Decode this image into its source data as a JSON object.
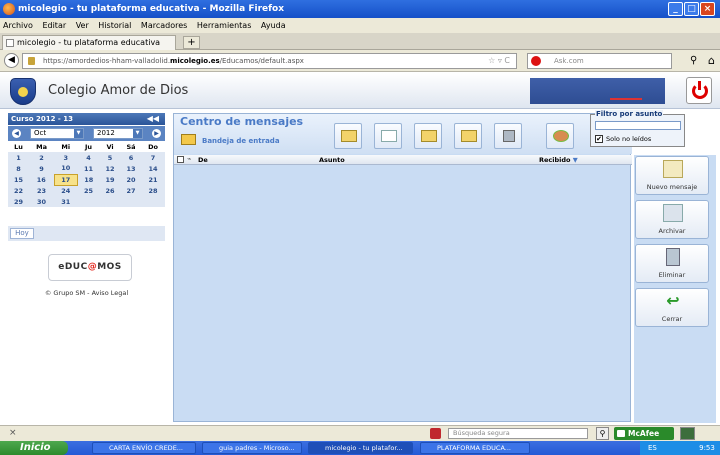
{
  "window": {
    "title": "micolegio - tu plataforma educativa - Mozilla Firefox"
  },
  "menu": [
    "Archivo",
    "Editar",
    "Ver",
    "Historial",
    "Marcadores",
    "Herramientas",
    "Ayuda"
  ],
  "tab": {
    "label": "micolegio - tu plataforma educativa",
    "new_tab": "+"
  },
  "address": {
    "host": "https://amordedios-hham-valladolid.",
    "domain": "micolegio.es",
    "path": "/Educamos/default.aspx",
    "search_placeholder": "Ask.com"
  },
  "site": {
    "name": "Colegio Amor de Dios",
    "calendar": {
      "course": "Curso 2012 - 13",
      "month": "Oct",
      "year": "2012",
      "day_headers": [
        "Lu",
        "Ma",
        "Mi",
        "Ju",
        "Vi",
        "Sá",
        "Do"
      ],
      "weeks": [
        [
          "1",
          "2",
          "3",
          "4",
          "5",
          "6",
          "7"
        ],
        [
          "8",
          "9",
          "10",
          "11",
          "12",
          "13",
          "14"
        ],
        [
          "15",
          "16",
          "17",
          "18",
          "19",
          "20",
          "21"
        ],
        [
          "22",
          "23",
          "24",
          "25",
          "26",
          "27",
          "28"
        ],
        [
          "29",
          "30",
          "31",
          "",
          "",
          "",
          ""
        ]
      ],
      "today": "17",
      "today_button": "Hoy"
    },
    "brand": {
      "pre": "e",
      "mid": "DUC",
      "co": "@",
      "post": "MOS"
    },
    "footer": "© Grupo SM - Aviso Legal",
    "messages": {
      "title": "Centro de mensajes",
      "folder": "Bandeja de entrada",
      "filter_label": "Filtro por asunto",
      "filter_value": "",
      "unread_only_label": "Solo no leídos",
      "unread_only_checked": "✔",
      "columns": {
        "from": "De",
        "subject": "Asunto",
        "received": "Recibido",
        "sort": "▼"
      }
    },
    "actions": [
      "Nuevo mensaje",
      "Archivar",
      "Eliminar",
      "Cerrar"
    ]
  },
  "statusbar": {
    "close": "×",
    "search_placeholder": "Búsqueda segura",
    "mcafee": "McAfee"
  },
  "taskbar": {
    "start": "Inicio",
    "tasks": [
      "CARTA ENVÍO CREDE...",
      "guia padres - Microso...",
      "micolegio - tu platafor...",
      "PLATAFORMA EDUCA..."
    ],
    "tray": "ES",
    "clock": "9:53"
  }
}
